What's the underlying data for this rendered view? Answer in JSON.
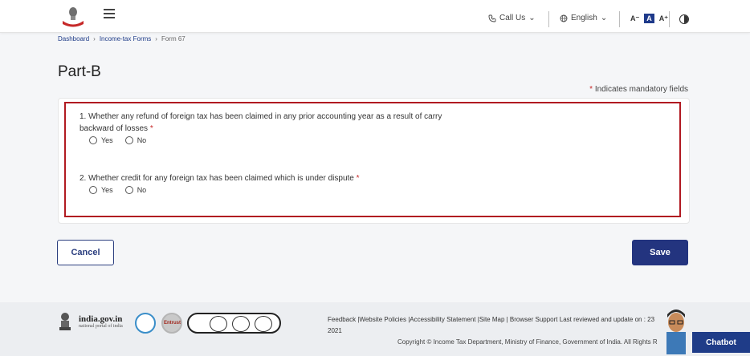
{
  "header": {
    "call_us": "Call Us",
    "language": "English",
    "font_decrease": "A⁻",
    "font_normal": "A",
    "font_increase": "A⁺"
  },
  "breadcrumb": [
    "Dashboard",
    "Income-tax Forms",
    "Form 67"
  ],
  "page": {
    "title": "Part-B",
    "mandatory_note": "Indicates mandatory fields"
  },
  "questions": [
    {
      "text": "1. Whether any refund of foreign tax has been claimed in any prior accounting year as a result of carry backward of losses",
      "options": [
        "Yes",
        "No"
      ]
    },
    {
      "text": "2. Whether credit for any foreign tax has been claimed which is under dispute",
      "options": [
        "Yes",
        "No"
      ]
    }
  ],
  "actions": {
    "cancel": "Cancel",
    "save": "Save"
  },
  "footer": {
    "indiagov_title": "india.gov.in",
    "indiagov_subtitle": "national portal of india",
    "entrust": "Entrust",
    "links": "Feedback |Website Policies |Accessibility Statement |Site Map | Browser Support",
    "last_reviewed": "Last reviewed and update on : 23",
    "year": "2021",
    "copyright": "Copyright © Income Tax Department, Ministry of Finance, Government of India. All Rights R"
  },
  "chatbot": "Chatbot",
  "colors": {
    "primary": "#23347f",
    "highlight_border": "#b11a21",
    "required_star": "#c62828"
  }
}
